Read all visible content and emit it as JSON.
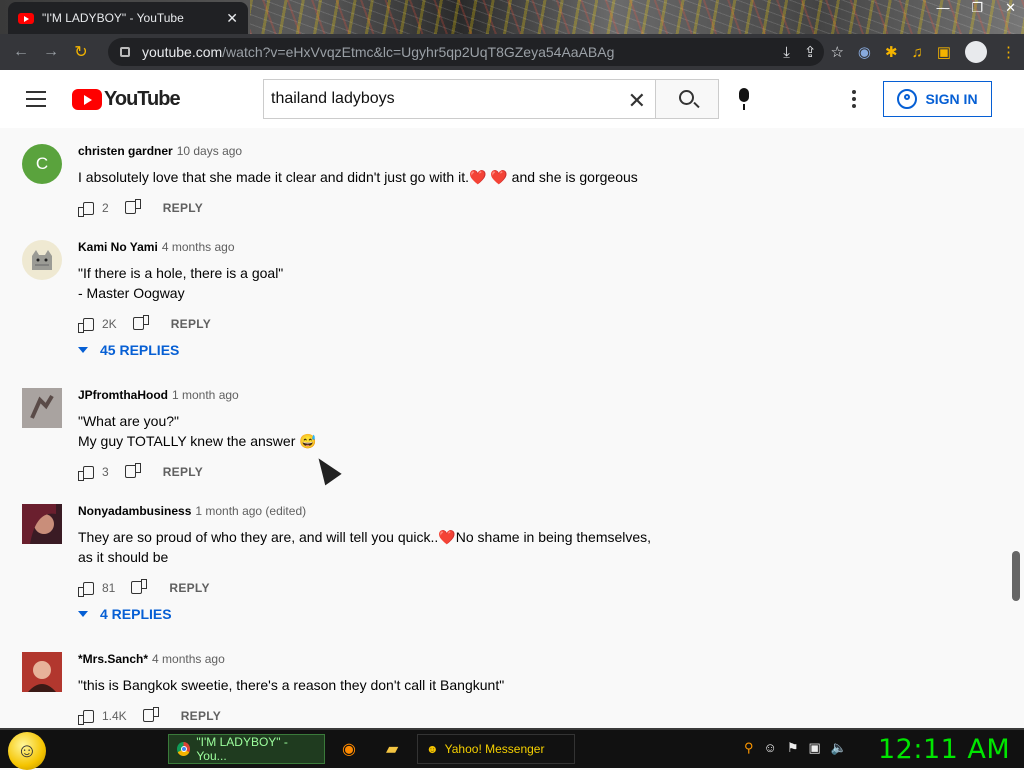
{
  "browser": {
    "tab_title": "\"I'M LADYBOY\" - YouTube",
    "tab_close": "✕",
    "window_controls": [
      "—",
      "❐",
      "✕"
    ],
    "url_host": "youtube.com",
    "url_rest": "/watch?v=eHxVvqzEtmc&lc=Ugyhr5qp2UqT8GZeya54AaABAg",
    "nav": {
      "back": "←",
      "forward": "→",
      "reload": "↻"
    }
  },
  "youtube": {
    "logo_text": "YouTube",
    "search_value": "thailand ladyboys",
    "search_clear": "✕",
    "sign_in_label": "SIGN IN"
  },
  "comments": [
    {
      "author": "christen gardner",
      "time": "10 days ago",
      "avatar_letter": "C",
      "avatar_color": "#5aa33d",
      "text_parts": [
        "I absolutely love that she made it clear and didn't just go with it.",
        "❤️",
        " ",
        "❤️",
        " and she is gorgeous"
      ],
      "likes": "2",
      "reply_label": "REPLY"
    },
    {
      "author": "Kami No Yami",
      "time": "4 months ago",
      "avatar_letter": "",
      "avatar_color": "#e9e2c8",
      "line1": "\"If there is a hole, there is a goal\"",
      "line2": "- Master Oogway",
      "likes": "2K",
      "reply_label": "REPLY",
      "replies_label": "45 REPLIES"
    },
    {
      "author": "JPfromthaHood",
      "time": "1 month ago",
      "avatar_letter": "",
      "avatar_color": "#9a8f8a",
      "line1": "\"What are you?\"",
      "line2": "My guy TOTALLY knew the answer 😅",
      "likes": "3",
      "reply_label": "REPLY"
    },
    {
      "author": "Nonyadambusiness",
      "time": "1 month ago (edited)",
      "avatar_letter": "",
      "avatar_color": "#7a2a3a",
      "line1_a": "They are so proud of who they are, and will tell you quick..",
      "line1_heart": "❤️",
      "line1_b": "No shame in being themselves,",
      "line2": "as it should be",
      "likes": "81",
      "reply_label": "REPLY",
      "replies_label": "4 REPLIES"
    },
    {
      "author": "*Mrs.Sanch*",
      "time": "4 months ago",
      "avatar_letter": "",
      "avatar_color": "#b2372e",
      "line1": "\"this is Bangkok sweetie, there's a reason they don't call it Bangkunt\"",
      "likes": "1.4K",
      "reply_label": "REPLY"
    }
  ],
  "taskbar": {
    "chrome_item": "\"I'M LADYBOY\" - You...",
    "yahoo_item": "Yahoo! Messenger",
    "clock": "12:11 AM"
  }
}
